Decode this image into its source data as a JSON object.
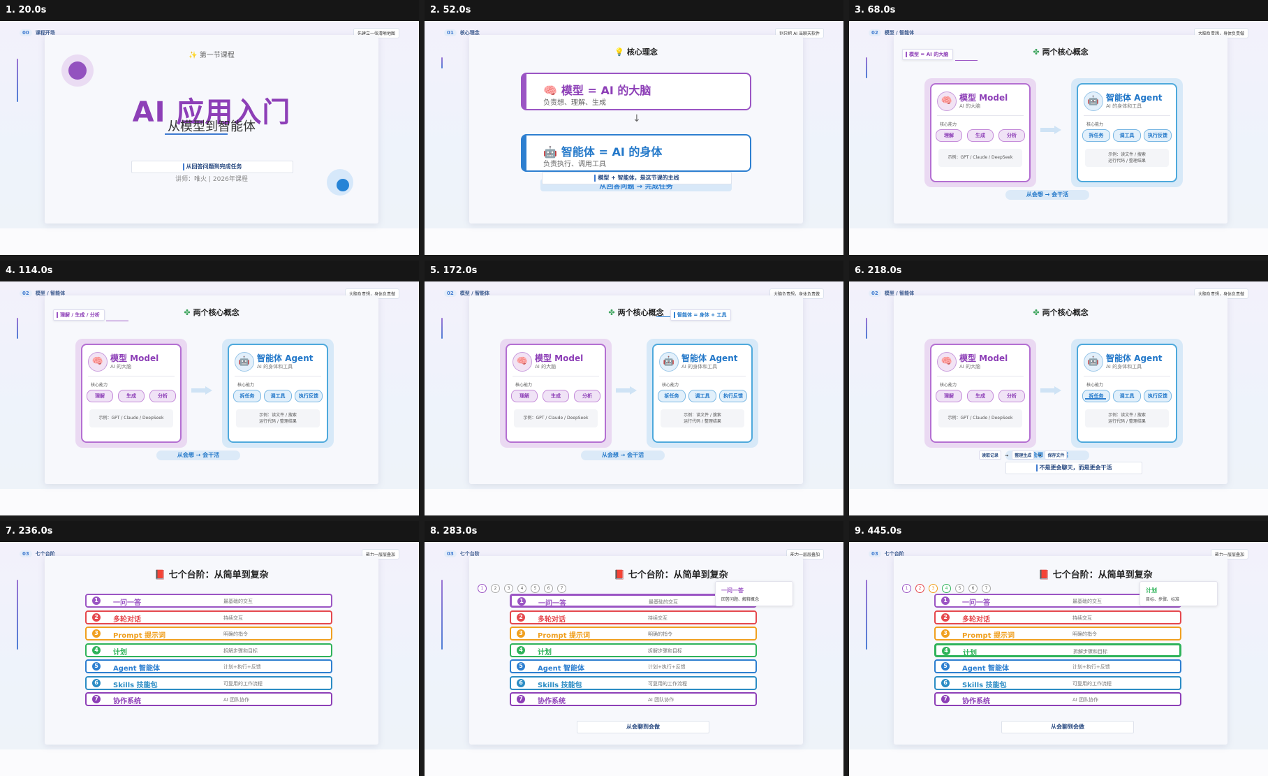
{
  "frames": [
    {
      "caption": "1. 20.0s",
      "page_num": "00",
      "page_label": "课程开场",
      "tag": "先建立一张清晰地图",
      "subtitle": "第一节课程",
      "title": "AI 应用入门",
      "title2": "从模型到智能体",
      "band": "从回答问题到完成任务",
      "lecturer": "讲师：唯火 | 2026年课程"
    },
    {
      "caption": "2. 52.0s",
      "page_num": "01",
      "page_label": "核心理念",
      "tag": "别只把 AI 当聊天软件",
      "heading": "核心理念",
      "box1_title": "模型 = AI 的大脑",
      "box1_sub": "负责想、理解、生成",
      "box2_title": "智能体 = AI 的身体",
      "box2_sub": "负责执行、调用工具",
      "band": "模型 + 智能体，是这节课的主线",
      "bar": "从回答问题 → 完成任务"
    },
    {
      "caption": "3. 68.0s",
      "page_num": "02",
      "page_label": "模型 / 智能体",
      "tag": "大脑负责想，身体负责做",
      "highlight": "模型 = AI 的大脑"
    },
    {
      "caption": "4. 114.0s",
      "page_num": "02",
      "page_label": "模型 / 智能体",
      "tag": "大脑负责想，身体负责做",
      "highlight": "理解 / 生成 / 分析"
    },
    {
      "caption": "5. 172.0s",
      "page_num": "02",
      "page_label": "模型 / 智能体",
      "tag": "大脑负责想，身体负责做",
      "highlight": "智能体 = 身体 + 工具"
    },
    {
      "caption": "6. 218.0s",
      "page_num": "02",
      "page_label": "模型 / 智能体",
      "tag": "大脑负责想，身体负责做",
      "flow": [
        "读取记录",
        "→",
        "整理生成",
        "→",
        "保存文件"
      ],
      "note": "不是更会聊天，而是更会干活"
    },
    {
      "caption": "7. 236.0s",
      "page_num": "03",
      "page_label": "七个台阶",
      "tag": "能力一层层叠加"
    },
    {
      "caption": "8. 283.0s",
      "page_num": "03",
      "page_label": "七个台阶",
      "tag": "能力一层层叠加",
      "tip_title": "一问一答",
      "tip_sub": "回答问题、解释概念",
      "bottom": "从会聊到会做"
    },
    {
      "caption": "9. 445.0s",
      "page_num": "03",
      "page_label": "七个台阶",
      "tag": "能力一层层叠加",
      "tip_title": "计划",
      "tip_sub": "目标、步骤、标准",
      "bottom": "从会聊到会做"
    }
  ],
  "concept": {
    "heading": "两个核心概念",
    "model": {
      "title": "模型 Model",
      "sub": "AI 的大脑",
      "cap": "核心能力",
      "chips": [
        "理解",
        "生成",
        "分析"
      ],
      "example": "示例：GPT / Claude / DeepSeek"
    },
    "agent": {
      "title": "智能体 Agent",
      "sub": "AI 的身体和工具",
      "cap": "核心能力",
      "chips": [
        "拆任务",
        "调工具",
        "执行反馈"
      ],
      "example1": "示例：读文件 / 搜索",
      "example2": "运行代码 / 整理结果"
    },
    "pill": "从会想 → 会干活"
  },
  "stairs": {
    "heading": "七个台阶：从简单到复杂",
    "items": [
      {
        "n": "1",
        "label": "一问一答",
        "desc": "最基础的交互",
        "color": "#9b55c4"
      },
      {
        "n": "2",
        "label": "多轮对话",
        "desc": "持续交互",
        "color": "#e5484d"
      },
      {
        "n": "3",
        "label": "Prompt 提示词",
        "desc": "明确的指令",
        "color": "#f0a020"
      },
      {
        "n": "4",
        "label": "计划",
        "desc": "拆解步骤和目标",
        "color": "#2fb35a"
      },
      {
        "n": "5",
        "label": "Agent 智能体",
        "desc": "计划+执行+反馈",
        "color": "#2d7fd0"
      },
      {
        "n": "6",
        "label": "Skills 技能包",
        "desc": "可复用的工作流程",
        "color": "#2b8cc4"
      },
      {
        "n": "7",
        "label": "协作系统",
        "desc": "AI 团队协作",
        "color": "#8d3fb7"
      }
    ]
  },
  "icons": {
    "sparkle": "sparkle-icon",
    "bulb": "bulb-icon",
    "brain": "brain-icon",
    "robot": "robot-icon",
    "clover": "clover-icon",
    "book": "book-icon"
  }
}
